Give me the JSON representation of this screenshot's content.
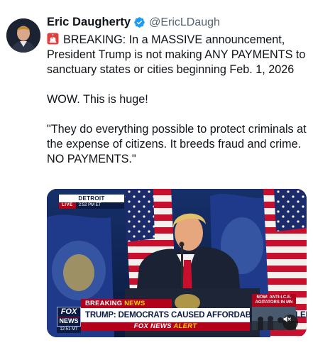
{
  "author": {
    "display_name": "Eric Daugherty",
    "handle": "@EricLDaugh",
    "verified_icon": "verified-badge-icon",
    "avatar_icon": "avatar"
  },
  "tweet": {
    "line1": "BREAKING: In a MASSIVE announcement, President Trump is not making ANY PAYMENTS to sanctuary states or cities beginning Feb. 1, 2026",
    "line2": "WOW. This is huge!",
    "line3": "\"They do everything possible to protect criminals at the expense of citizens. It breeds fraud and crime. NO PAYMENTS.\"",
    "siren_icon": "siren-icon"
  },
  "media": {
    "location": "DETROIT",
    "live_label": "LIVE",
    "live_time": "2:52 PM ET",
    "breaking_label": "BREAKING",
    "news_label": "NEWS",
    "headline": "TRUMP: DEMOCRATS CAUSED AFFORDABILITY PROBLEM",
    "network_prefix": "FOX NEWS",
    "alert_label": "ALERT",
    "logo_fox": "FOX",
    "logo_news": "NEWS",
    "clock": "12:51 MT",
    "side_headline": "NOW: ANTI-I.C.E. AGITATORS IN MN",
    "mute_icon": "mute-icon",
    "colors": {
      "fox_red": "#b3001b",
      "fox_navy": "#0b1b45",
      "fox_yellow": "#ffd400"
    }
  },
  "colors": {
    "text_primary": "#0f1419",
    "text_secondary": "#536471",
    "verified_blue": "#1d9bf0"
  }
}
